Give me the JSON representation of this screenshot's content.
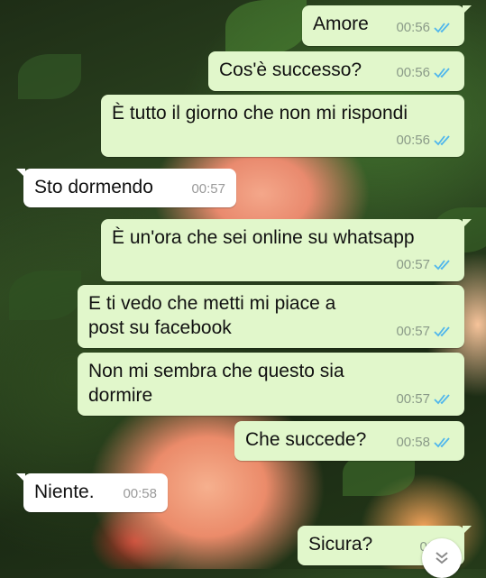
{
  "messages": [
    {
      "text": "Amore",
      "time": "00:56",
      "dir": "out",
      "status": "read"
    },
    {
      "text": "Cos'è successo?",
      "time": "00:56",
      "dir": "out",
      "status": "read"
    },
    {
      "text": "È tutto il giorno che non mi rispondi",
      "time": "00:56",
      "dir": "out",
      "status": "read"
    },
    {
      "text": "Sto dormendo",
      "time": "00:57",
      "dir": "in"
    },
    {
      "text": "È un'ora che sei online su whatsapp",
      "time": "00:57",
      "dir": "out",
      "status": "read"
    },
    {
      "text": "E ti vedo che metti mi piace a post su facebook",
      "time": "00:57",
      "dir": "out",
      "status": "read"
    },
    {
      "text": "Non mi sembra che questo sia dormire",
      "time": "00:57",
      "dir": "out",
      "status": "read"
    },
    {
      "text": "Che succede?",
      "time": "00:58",
      "dir": "out",
      "status": "read"
    },
    {
      "text": "Niente.",
      "time": "00:58",
      "dir": "in"
    },
    {
      "text": "Sicura?",
      "time": "00:58",
      "dir": "out",
      "status": "read"
    }
  ],
  "colors": {
    "outgoing_bubble": "#e1f7cb",
    "incoming_bubble": "#ffffff",
    "read_ticks": "#4fb6ec",
    "timestamp": "#8a9a88"
  },
  "icons": {
    "read_receipt": "double-check-icon",
    "scroll_down": "chevron-double-down-icon"
  }
}
